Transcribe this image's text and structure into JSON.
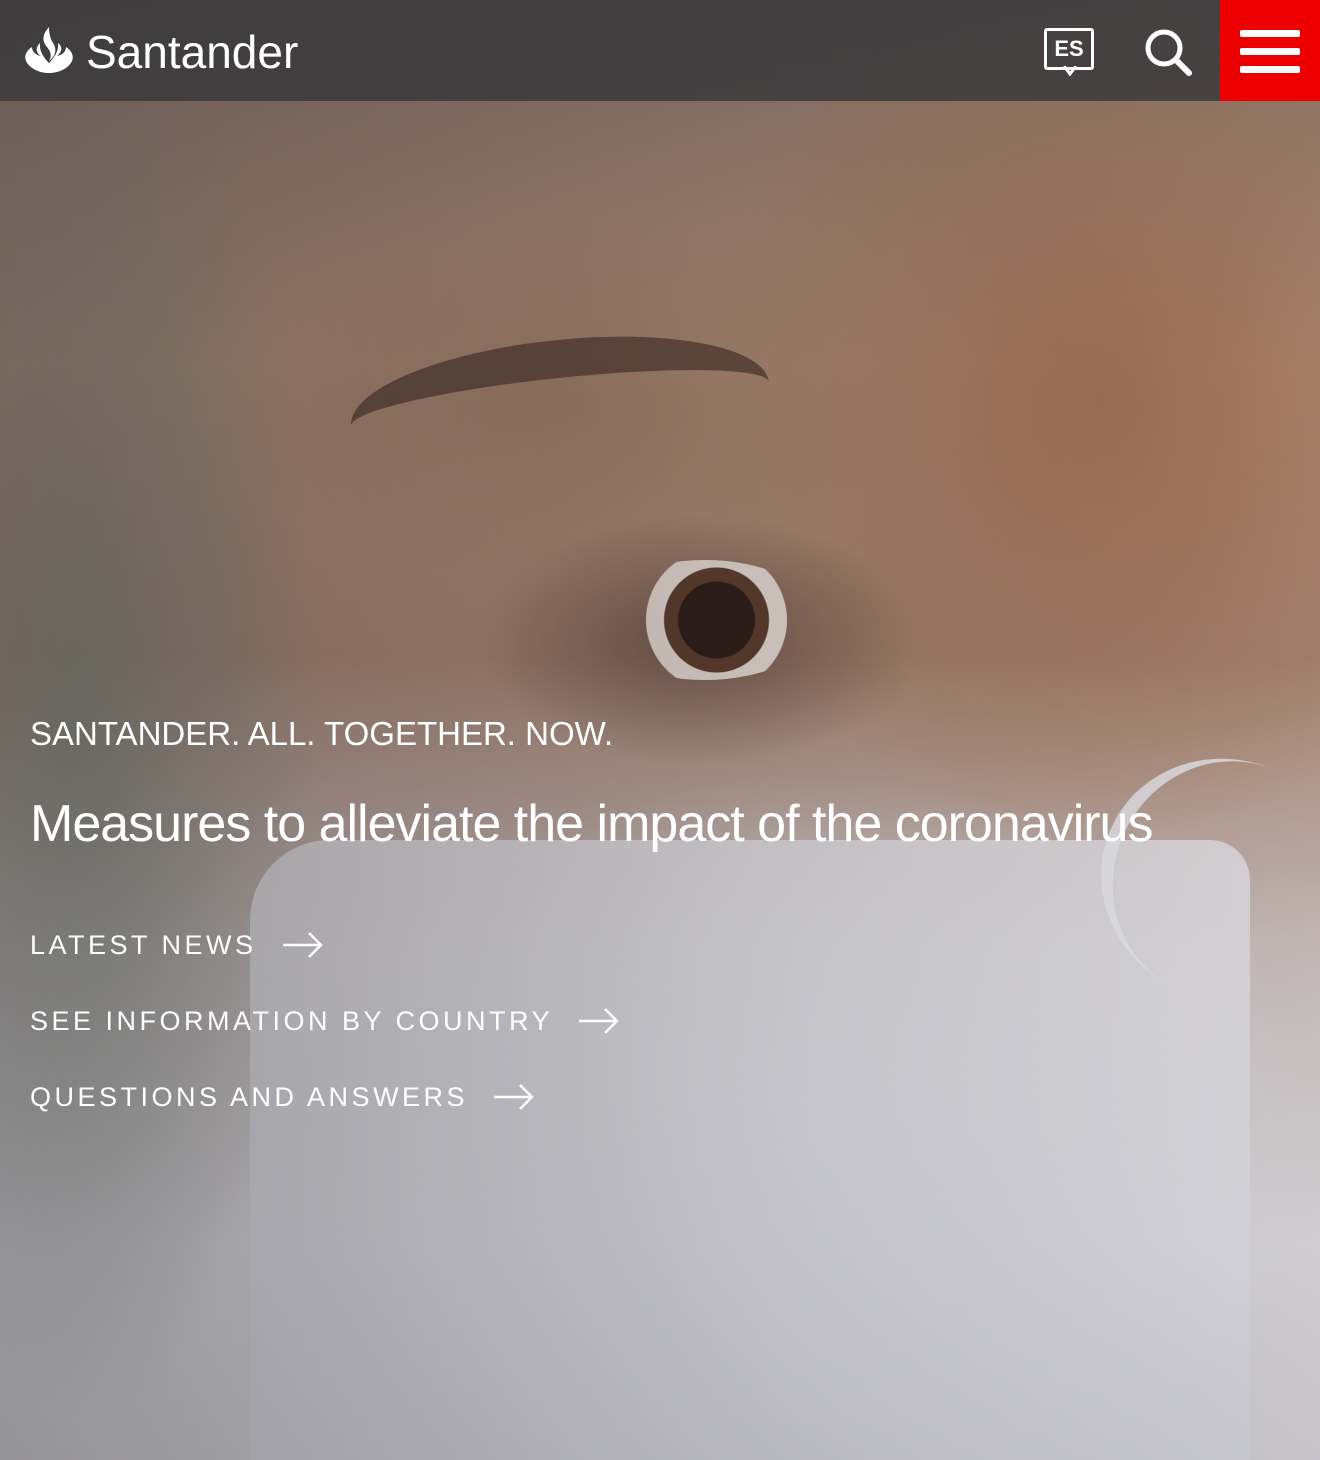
{
  "header": {
    "brand": "Santander",
    "language_label": "ES",
    "search_icon": "search-icon",
    "menu_icon": "hamburger-menu-icon",
    "colors": {
      "header_bg": "#37373a",
      "menu_bg": "#ec0000",
      "text": "#ffffff"
    }
  },
  "hero": {
    "eyebrow": "SANTANDER. ALL. TOGETHER. NOW.",
    "headline": "Measures to alleviate the impact of the coronavirus",
    "links": [
      {
        "label": "LATEST NEWS",
        "icon": "arrow-right-icon"
      },
      {
        "label": "SEE INFORMATION BY COUNTRY",
        "icon": "arrow-right-icon"
      },
      {
        "label": "QUESTIONS AND ANSWERS",
        "icon": "arrow-right-icon"
      }
    ]
  }
}
